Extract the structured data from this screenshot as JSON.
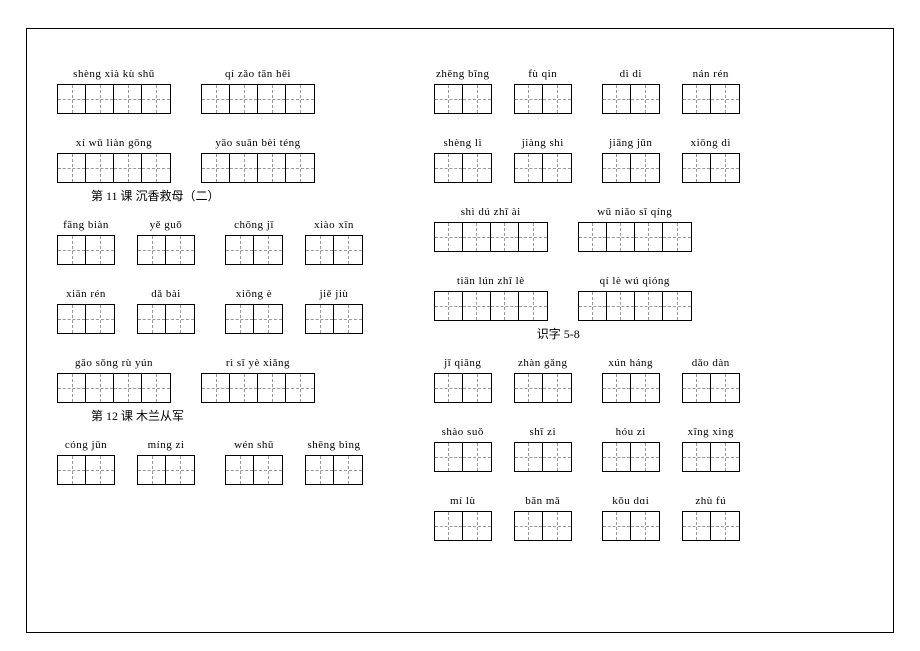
{
  "headings": {
    "h11": "第 11 课  沉香救母（二）",
    "h12": "第 12 课  木兰从军",
    "hzi": "识字  5-8"
  },
  "left": {
    "r1": {
      "a": "shèng  xià   kù   shǔ",
      "b": "qí   zǎo  tān   hēi"
    },
    "r2": {
      "a": "xí    wǔ   liàn  gōng",
      "b": "yāo suān  bèi  téng"
    },
    "r3": {
      "a": "fāng biàn",
      "b": "yě  guǒ",
      "c": "chōng  jī",
      "d": "xiào  xīn"
    },
    "r4": {
      "a": "xiān rén",
      "b": "dǎ  bài",
      "c": "xiōng  è",
      "d": "jiě   jiù"
    },
    "r5": {
      "a": "gāo sǒng  rù   yún",
      "b": "rì    sī   yè  xiǎng"
    },
    "r6": {
      "a": "cóng  jūn",
      "b": "míng  zi",
      "c": "wén shū",
      "d": "shēng bìng"
    }
  },
  "right": {
    "r1": {
      "a": "zhēng bīng",
      "b": "fù   qin",
      "c": "dì   di",
      "d": "nán rén"
    },
    "r2": {
      "a": "shèng  lì",
      "b": "jiàng  shi",
      "c": "jiāng  jūn",
      "d": "xiōng dì"
    },
    "r3": {
      "a": "shì   dú   zhī   ài",
      "b": "wū   niǎo   sī   qíng"
    },
    "r4": {
      "a": "tiān   lún   zhī   lè",
      "b": "qí   lè   wú qióng"
    },
    "r5": {
      "a": "jī qiāng",
      "b": "zhàn gǎng",
      "c": "xún  háng",
      "d": "dǎo  dàn"
    },
    "r6": {
      "a": "shào suǒ",
      "b": "shī   zi",
      "c": "hóu   zi",
      "d": "xīng  xing"
    },
    "r7": {
      "a": "mí   lù",
      "b": "bān  mǎ",
      "c": "kǒu  dɑi",
      "d": "zhù   fú"
    }
  }
}
